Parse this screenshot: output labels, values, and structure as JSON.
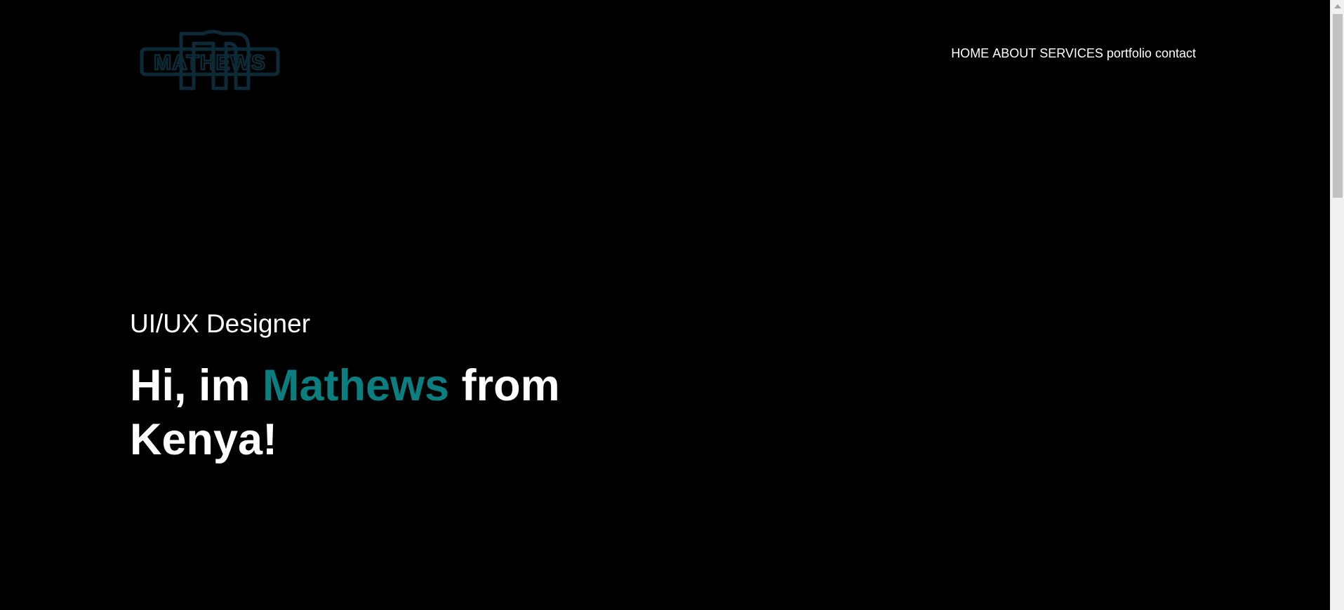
{
  "logo": {
    "text": "MATHEWS",
    "color": "#0d2a36"
  },
  "nav": {
    "items": [
      {
        "label": "HOME"
      },
      {
        "label": "ABOUT"
      },
      {
        "label": "SERVICES"
      },
      {
        "label": "portfolio"
      },
      {
        "label": "contact"
      }
    ]
  },
  "hero": {
    "role": "UI/UX Designer",
    "greeting_prefix": "Hi, im ",
    "name": "Mathews",
    "greeting_suffix": " from",
    "location_line": "Kenya!",
    "accent_color": "#0b7f7f"
  },
  "colors": {
    "background": "#000000",
    "text": "#ffffff"
  }
}
